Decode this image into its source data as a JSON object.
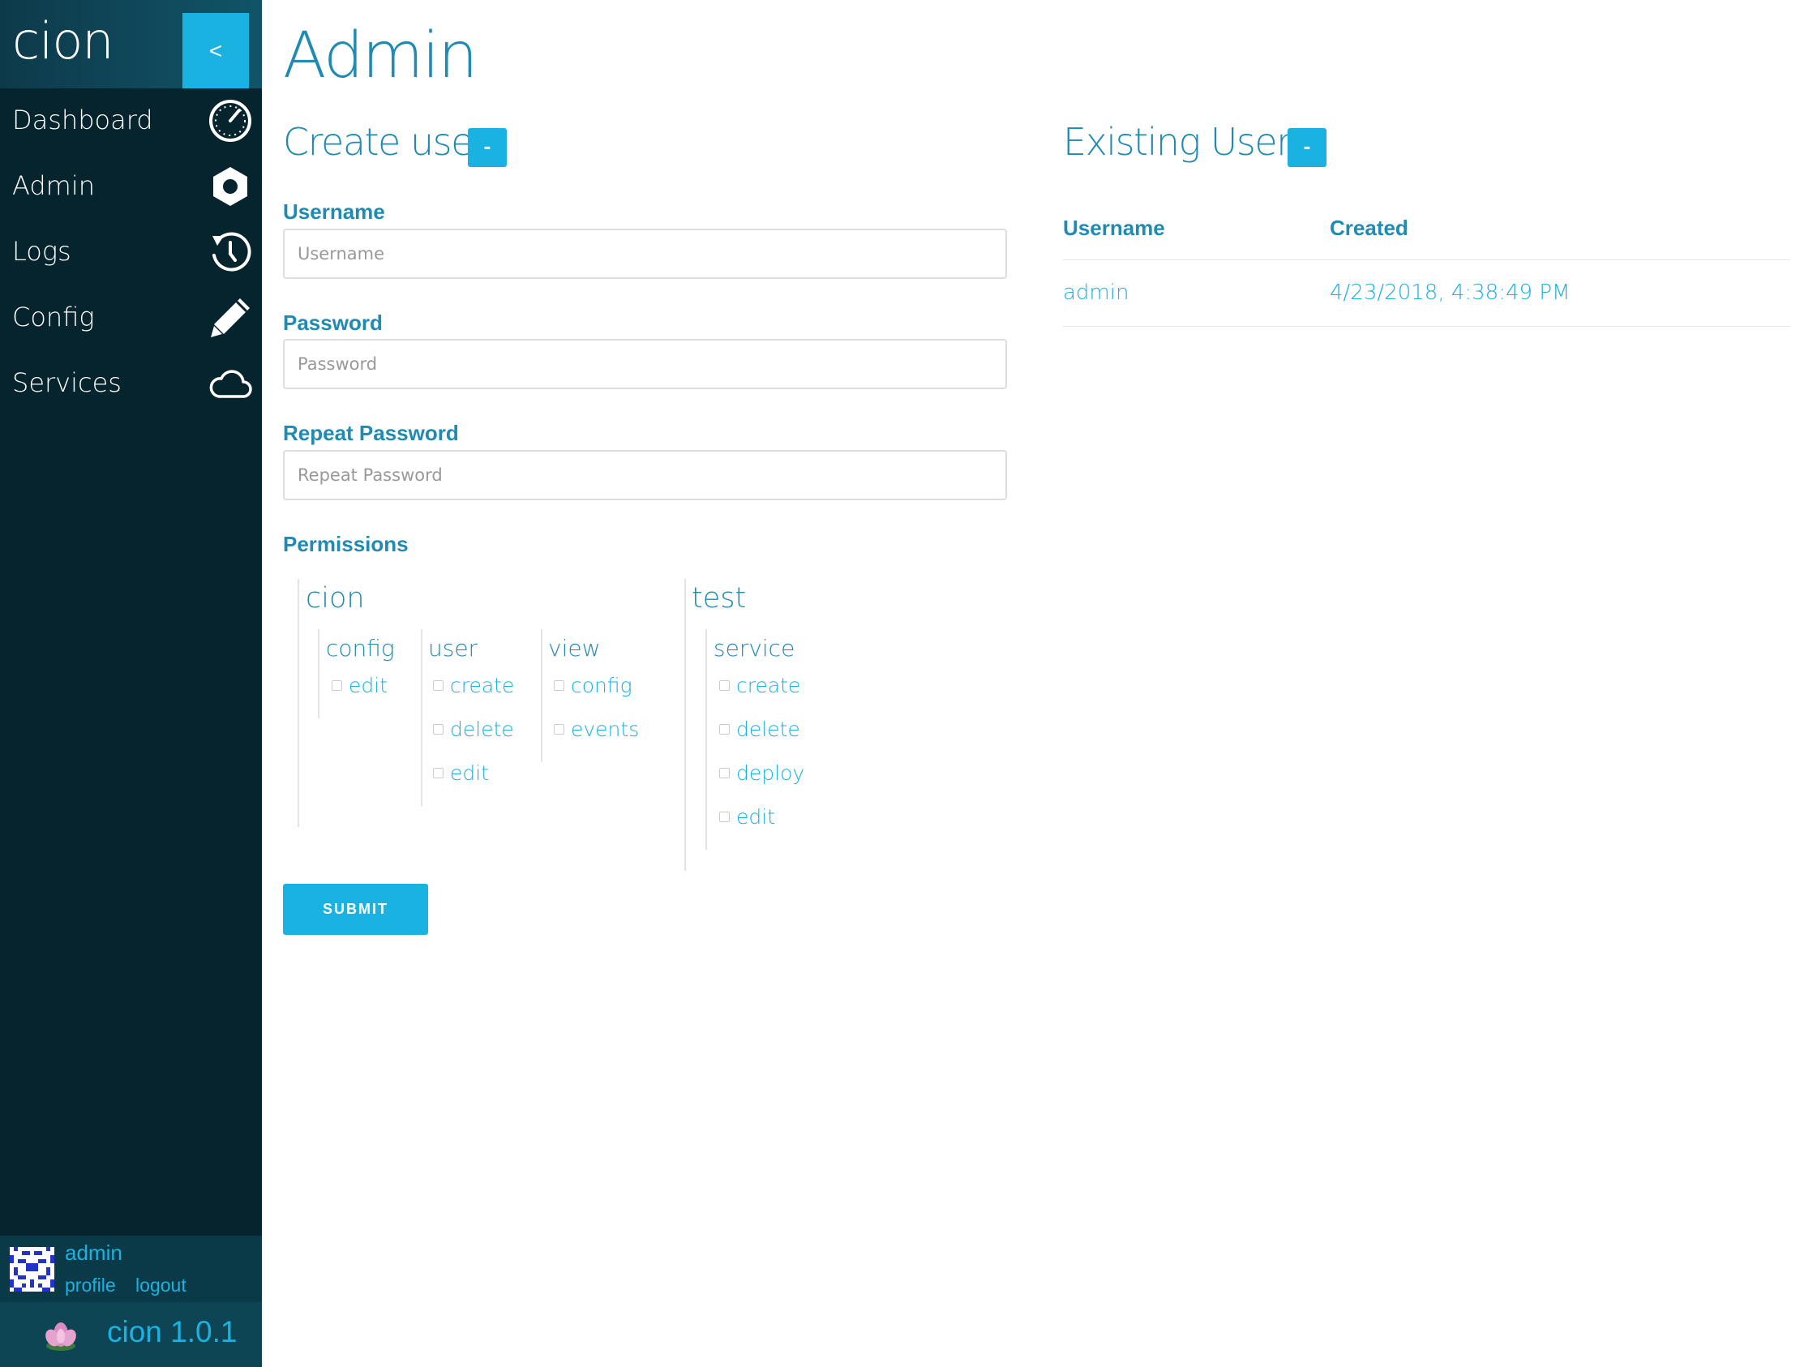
{
  "brand": {
    "name": "cion",
    "collapse_label": "<"
  },
  "nav": [
    {
      "label": "Dashboard",
      "icon": "dashboard-gauge-icon"
    },
    {
      "label": "Admin",
      "icon": "hexagon-icon"
    },
    {
      "label": "Logs",
      "icon": "history-clock-icon"
    },
    {
      "label": "Config",
      "icon": "pencil-icon"
    },
    {
      "label": "Services",
      "icon": "cloud-icon"
    }
  ],
  "user": {
    "name": "admin",
    "profile_label": "profile",
    "logout_label": "logout"
  },
  "version": {
    "text": "cion 1.0.1"
  },
  "page": {
    "title": "Admin"
  },
  "create_user": {
    "title": "Create user",
    "toggle_label": "-",
    "username_label": "Username",
    "username_placeholder": "Username",
    "password_label": "Password",
    "password_placeholder": "Password",
    "repeat_label": "Repeat Password",
    "repeat_placeholder": "Repeat Password",
    "permissions_label": "Permissions",
    "submit_label": "SUBMIT"
  },
  "permissions": [
    {
      "name": "cion",
      "categories": [
        {
          "name": "config",
          "items": [
            "edit"
          ]
        },
        {
          "name": "user",
          "items": [
            "create",
            "delete",
            "edit"
          ]
        },
        {
          "name": "view",
          "items": [
            "config",
            "events"
          ]
        }
      ]
    },
    {
      "name": "test",
      "categories": [
        {
          "name": "service",
          "items": [
            "create",
            "delete",
            "deploy",
            "edit"
          ]
        }
      ]
    }
  ],
  "existing_users": {
    "title": "Existing Users",
    "toggle_label": "-",
    "columns": [
      "Username",
      "Created"
    ],
    "rows": [
      {
        "username": "admin",
        "created": "4/23/2018, 4:38:49 PM"
      }
    ]
  },
  "colors": {
    "sidebar": "#06242e",
    "accent": "#1ab2e0",
    "text": "#1f8bb3"
  }
}
